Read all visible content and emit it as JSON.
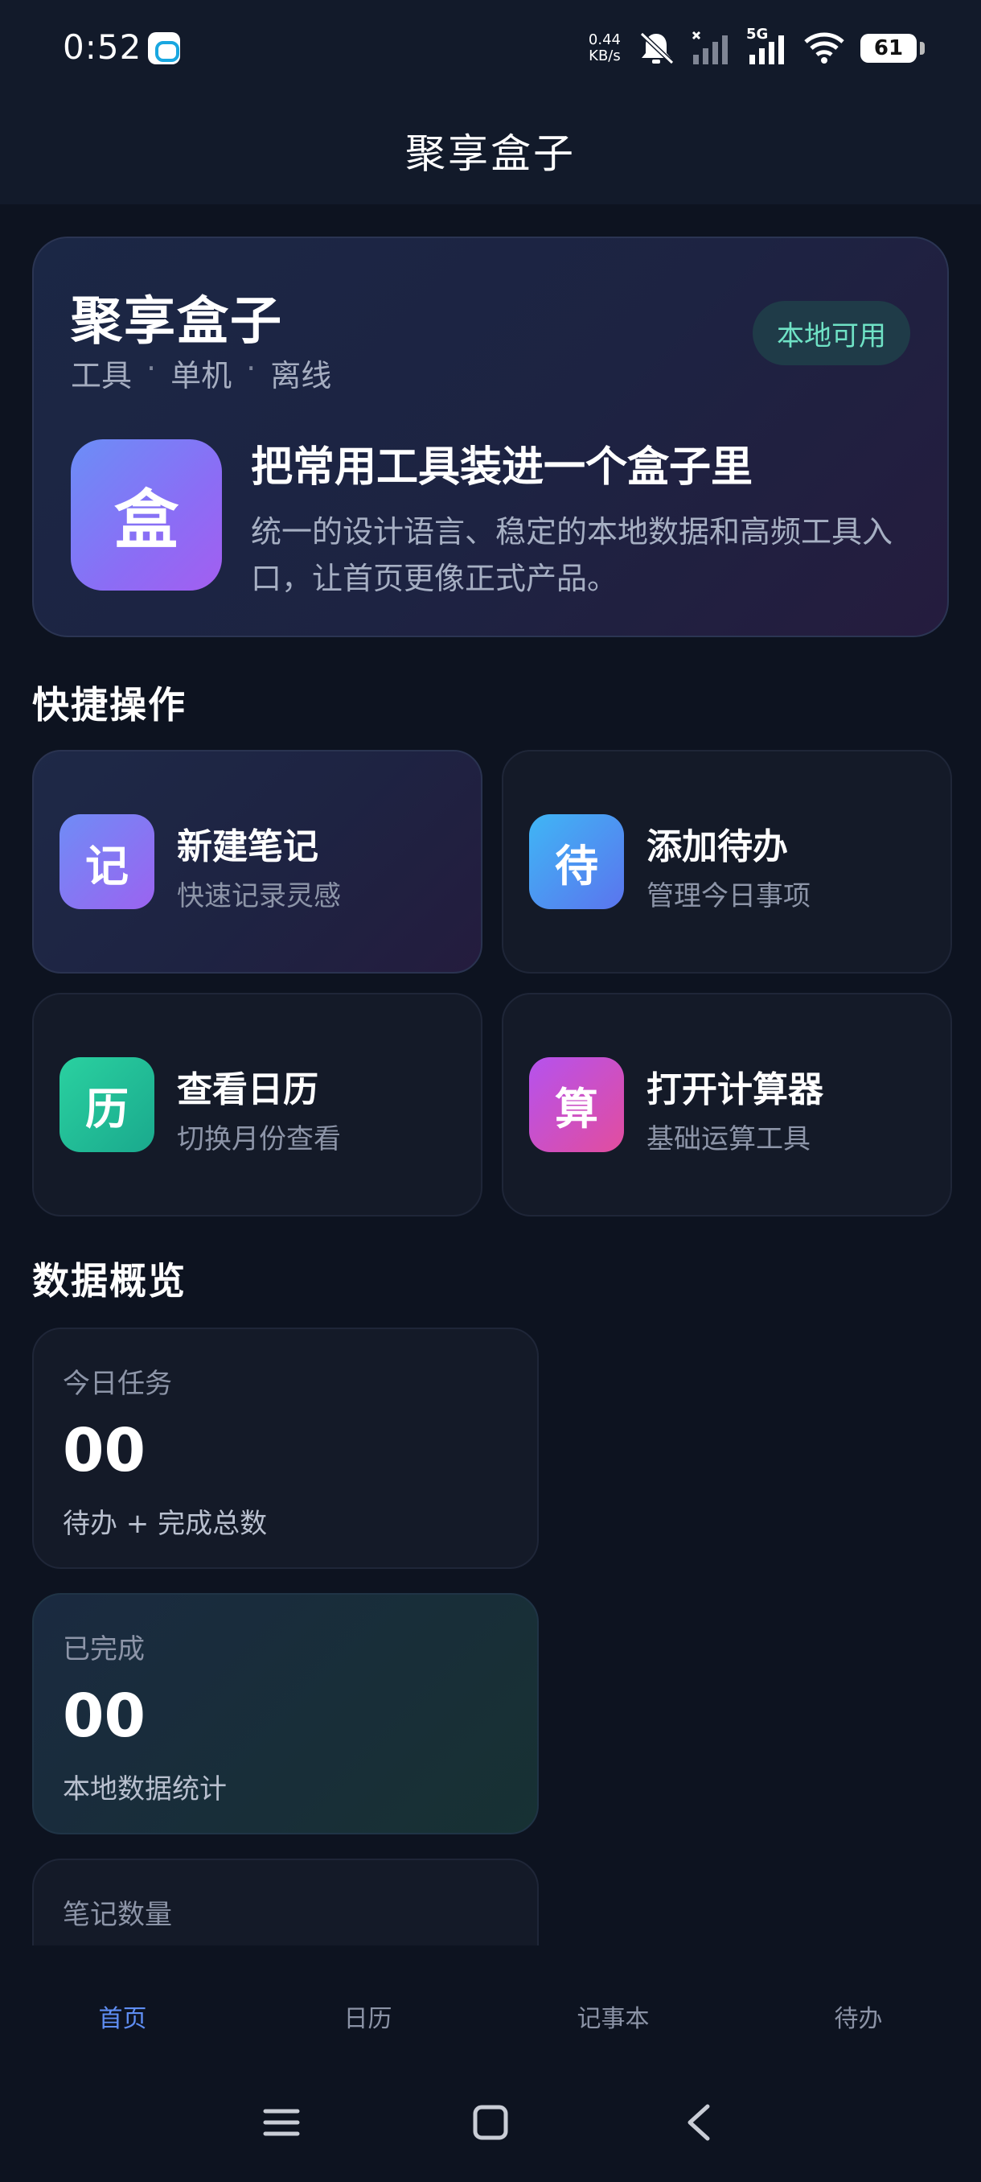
{
  "status_bar": {
    "time": "0:52",
    "speed_value": "0.44",
    "speed_unit": "KB/s",
    "network": "5G",
    "battery": "61"
  },
  "app_bar": {
    "title": "聚享盒子"
  },
  "hero": {
    "title": "聚享盒子",
    "tags": [
      "工具",
      "单机",
      "离线"
    ],
    "tag_separator": "·",
    "badge": "本地可用",
    "icon_char": "盒",
    "headline": "把常用工具装进一个盒子里",
    "description": "统一的设计语言、稳定的本地数据和高频工具入口，让首页更像正式产品。"
  },
  "quick_actions": {
    "heading": "快捷操作",
    "items": [
      {
        "icon_char": "记",
        "title": "新建笔记",
        "subtitle": "快速记录灵感",
        "color_from": "#6f8cf6",
        "color_to": "#9b63f0"
      },
      {
        "icon_char": "待",
        "title": "添加待办",
        "subtitle": "管理今日事项",
        "color_from": "#3fb6f5",
        "color_to": "#5b74ee"
      },
      {
        "icon_char": "历",
        "title": "查看日历",
        "subtitle": "切换月份查看",
        "color_from": "#2ad1a0",
        "color_to": "#1aa98d"
      },
      {
        "icon_char": "算",
        "title": "打开计算器",
        "subtitle": "基础运算工具",
        "color_from": "#b552ee",
        "color_to": "#e24d9e"
      }
    ]
  },
  "overview": {
    "heading": "数据概览",
    "cards": [
      {
        "label": "今日任务",
        "value": "00",
        "desc": "待办 + 完成总数"
      },
      {
        "label": "已完成",
        "value": "00",
        "desc": "本地数据统计"
      },
      {
        "label": "笔记数量",
        "value": "",
        "desc": ""
      }
    ]
  },
  "bottom_nav": {
    "items": [
      "首页",
      "日历",
      "记事本",
      "待办"
    ],
    "active_index": 0
  }
}
